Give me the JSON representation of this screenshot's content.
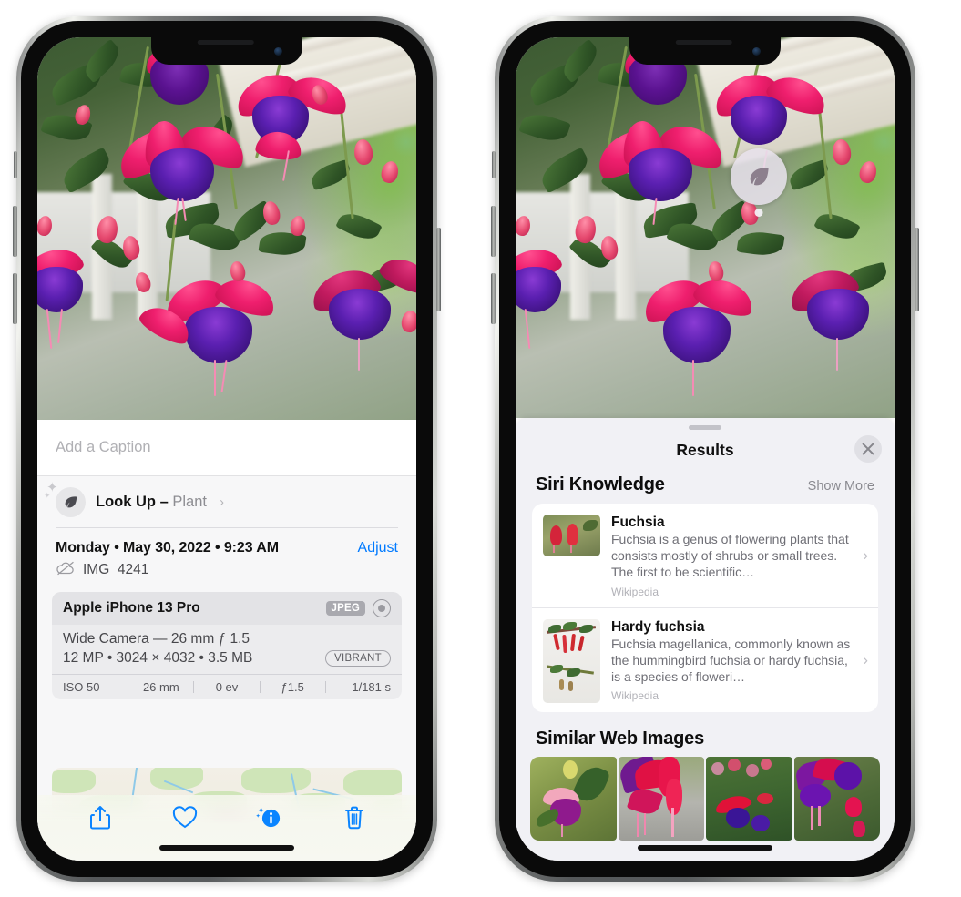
{
  "left_phone": {
    "name": "Photos app — photo info view",
    "caption": {
      "placeholder": "Add a Caption",
      "value": ""
    },
    "lookup": {
      "label_bold": "Look Up – ",
      "label_sub": "Plant",
      "chevron": "›",
      "icon": "leaf-icon"
    },
    "date_row": {
      "date": "Monday • May 30, 2022 • 9:23 AM",
      "adjust": "Adjust"
    },
    "file_row": {
      "icon": "cloud-slash-icon",
      "filename": "IMG_4241"
    },
    "meta": {
      "device": "Apple iPhone 13 Pro",
      "format_badge": "JPEG",
      "lens_icon": "aperture-icon",
      "lens_line": "Wide Camera — 26 mm ƒ 1.5",
      "size_line": "12 MP • 3024 × 4032 • 3.5 MB",
      "style_badge": "VIBRANT",
      "exif": [
        "ISO 50",
        "26 mm",
        "0 ev",
        "ƒ1.5",
        "1/181 s"
      ]
    },
    "toolbar": [
      {
        "name": "share-button",
        "icon": "share-icon"
      },
      {
        "name": "favorite-button",
        "icon": "heart-icon"
      },
      {
        "name": "info-button",
        "icon": "info-sparkle-icon"
      },
      {
        "name": "delete-button",
        "icon": "trash-icon"
      }
    ]
  },
  "right_phone": {
    "name": "Photos app — Visual Look Up results",
    "badge": {
      "icon": "leaf-icon"
    },
    "sheet": {
      "title": "Results",
      "close_icon": "close-icon",
      "siri_section": {
        "title": "Siri Knowledge",
        "action": "Show More",
        "items": [
          {
            "title": "Fuchsia",
            "description": "Fuchsia is a genus of flowering plants that consists mostly of shrubs or small trees. The first to be scientific…",
            "source": "Wikipedia",
            "chevron": "›"
          },
          {
            "title": "Hardy fuchsia",
            "description": "Fuchsia magellanica, commonly known as the hummingbird fuchsia or hardy fuchsia, is a species of floweri…",
            "source": "Wikipedia",
            "chevron": "›"
          }
        ]
      },
      "web_section": {
        "title": "Similar Web Images",
        "thumbs": [
          "web-image-1",
          "web-image-2",
          "web-image-3",
          "web-image-4"
        ]
      }
    }
  },
  "colors": {
    "accent_blue": "#007aff",
    "sheet_bg": "#f1f1f5",
    "panel_bg": "#f7f7f8",
    "card_bg": "#ffffff",
    "muted_text": "#8a8a90"
  }
}
